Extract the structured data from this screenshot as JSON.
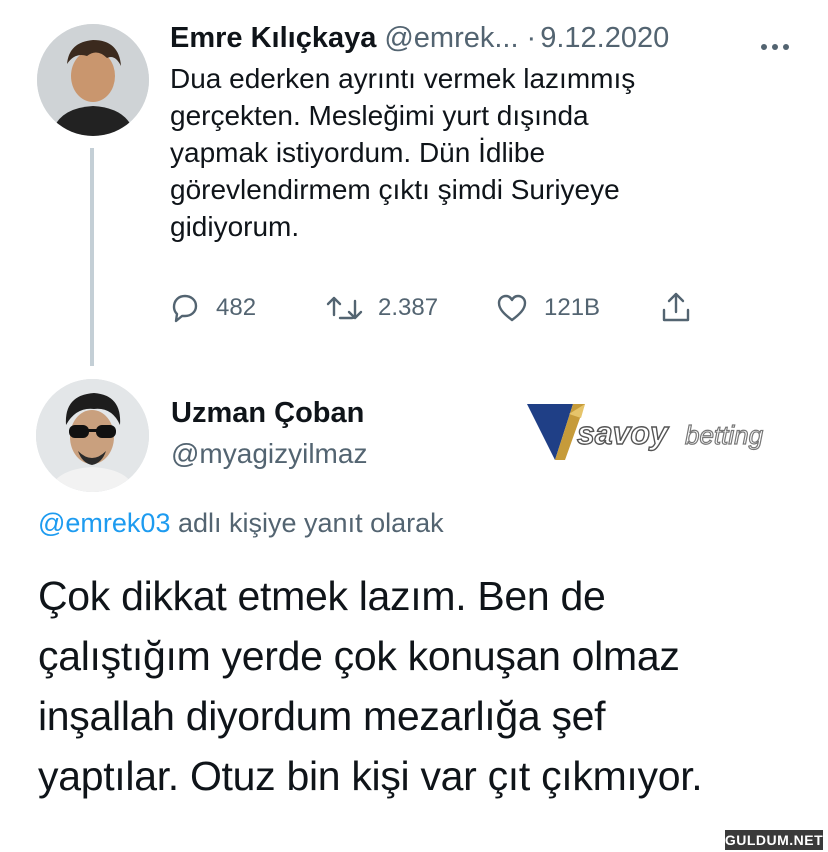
{
  "tweet1": {
    "name": "Emre Kılıçkaya",
    "handle": "@emrek...",
    "separator": "·",
    "date": "9.12.2020",
    "text_lines": [
      "Dua ederken ayrıntı vermek lazımmış",
      "gerçekten. Mesleğimi yurt dışında",
      "yapmak istiyordum. Dün İdlibe",
      "görevlendirmem çıktı şimdi Suriyeye",
      "gidiyorum."
    ],
    "actions": {
      "reply": {
        "icon": "reply-icon",
        "count": "482"
      },
      "retweet": {
        "icon": "retweet-icon",
        "count": "2.387"
      },
      "like": {
        "icon": "heart-icon",
        "count": "121B"
      },
      "share": {
        "icon": "share-icon"
      }
    }
  },
  "tweet2": {
    "name": "Uzman Çoban",
    "handle": "@myagizyilmaz",
    "replying_prefix": "",
    "replying_mention": "@emrek03",
    "replying_suffix": "adlı kişiye yanıt olarak",
    "text_lines": [
      "Çok dikkat etmek lazım. Ben de",
      "çalıştığım yerde çok konuşan olmaz",
      "inşallah diyordum mezarlığa şef",
      "yaptılar. Otuz bin kişi var çıt çıkmıyor."
    ]
  },
  "watermark": {
    "text": "savoybetting"
  },
  "corner_badge": {
    "text": "GULDUM.NET"
  },
  "colors": {
    "text": "#0f1419",
    "secondary": "#536471",
    "link": "#1d9bf0",
    "thread_line": "#c4cfd6"
  }
}
